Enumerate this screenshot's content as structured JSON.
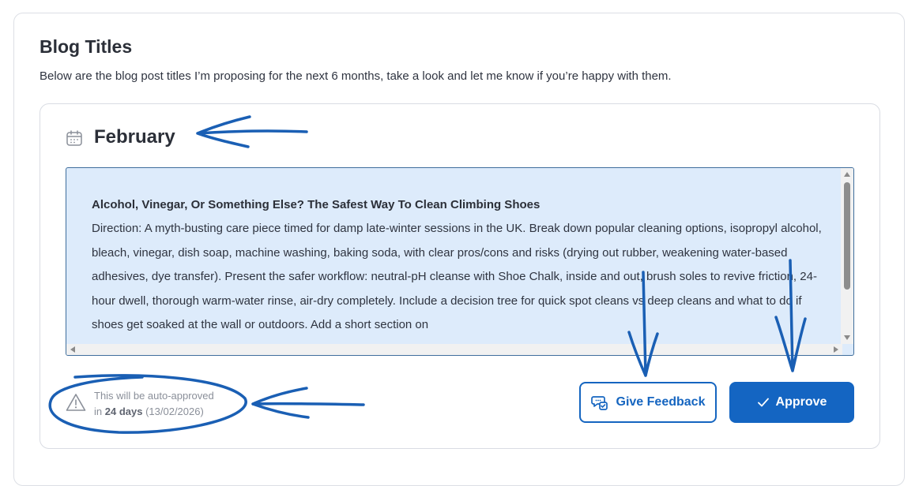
{
  "header": {
    "title": "Blog Titles",
    "subtitle": "Below are the blog post titles I’m proposing for the next 6 months, take a look and let me know if you’re happy with them."
  },
  "month": {
    "name": "February",
    "icon": "calendar-icon"
  },
  "post": {
    "title": "Alcohol, Vinegar, Or Something Else? The Safest Way To Clean Climbing Shoes",
    "body": "Direction: A myth-busting care piece timed for damp late-winter sessions in the UK. Break down popular cleaning options, isopropyl alcohol, bleach, vinegar, dish soap, machine washing, baking soda, with clear pros/cons and risks (drying out rubber, weakening water-based adhesives, dye transfer). Present the safer workflow: neutral-pH cleanse with Shoe Chalk, inside and out, brush soles to revive friction, 24-hour dwell, thorough warm-water rinse, air-dry completely. Include a decision tree for quick spot cleans vs deep cleans and what to do if shoes get soaked at the wall or outdoors. Add a short section on"
  },
  "auto_approve": {
    "line1": "This will be auto-approved",
    "prefix": "in",
    "days": "24 days",
    "date": "(13/02/2026)",
    "icon": "warning-icon"
  },
  "actions": {
    "feedback_label": "Give Feedback",
    "approve_label": "Approve"
  },
  "colors": {
    "accent": "#1465c2",
    "content_bg": "#ddebfb",
    "annotation": "#1a5fb4"
  }
}
